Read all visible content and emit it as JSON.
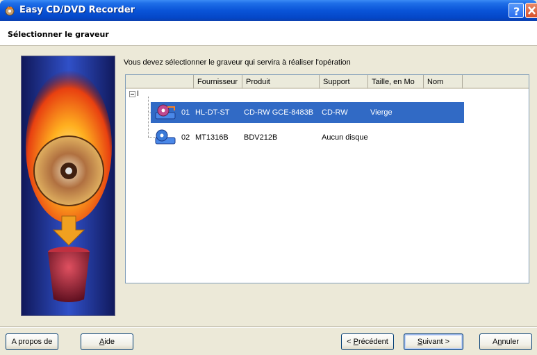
{
  "window": {
    "title": "Easy CD/DVD Recorder",
    "help_glyph": "?",
    "close_glyph": "✕"
  },
  "header": {
    "heading": "Sélectionner le graveur"
  },
  "instruction": "Vous devez sélectionner le graveur qui servira à réaliser l'opération",
  "list": {
    "columns": [
      "",
      "Fournisseur",
      "Produit",
      "Support",
      "Taille, en Mo",
      "Nom",
      ""
    ],
    "root_label": "I",
    "rows": [
      {
        "index": "01",
        "fournisseur": "HL-DT-ST",
        "produit": "CD-RW GCE-8483B",
        "support": "CD-RW",
        "taille": "Vierge",
        "nom": "",
        "selected": true
      },
      {
        "index": "02",
        "fournisseur": "MT1316B",
        "produit": "BDV212B",
        "support": "Aucun disque",
        "taille": "",
        "nom": "",
        "selected": false
      }
    ]
  },
  "buttons": {
    "about": "A propos de",
    "help_prefix": "",
    "help_mnemonic": "A",
    "help_suffix": "ide",
    "prev_prefix": "< ",
    "prev_mnemonic": "P",
    "prev_suffix": "récédent",
    "next_mnemonic": "S",
    "next_suffix": "uivant >",
    "cancel_prefix": "A",
    "cancel_mnemonic": "n",
    "cancel_suffix": "nuler"
  },
  "colors": {
    "selection": "#316ac5",
    "titlebar": "#0a54d8",
    "dialog_bg": "#ece9d8"
  }
}
